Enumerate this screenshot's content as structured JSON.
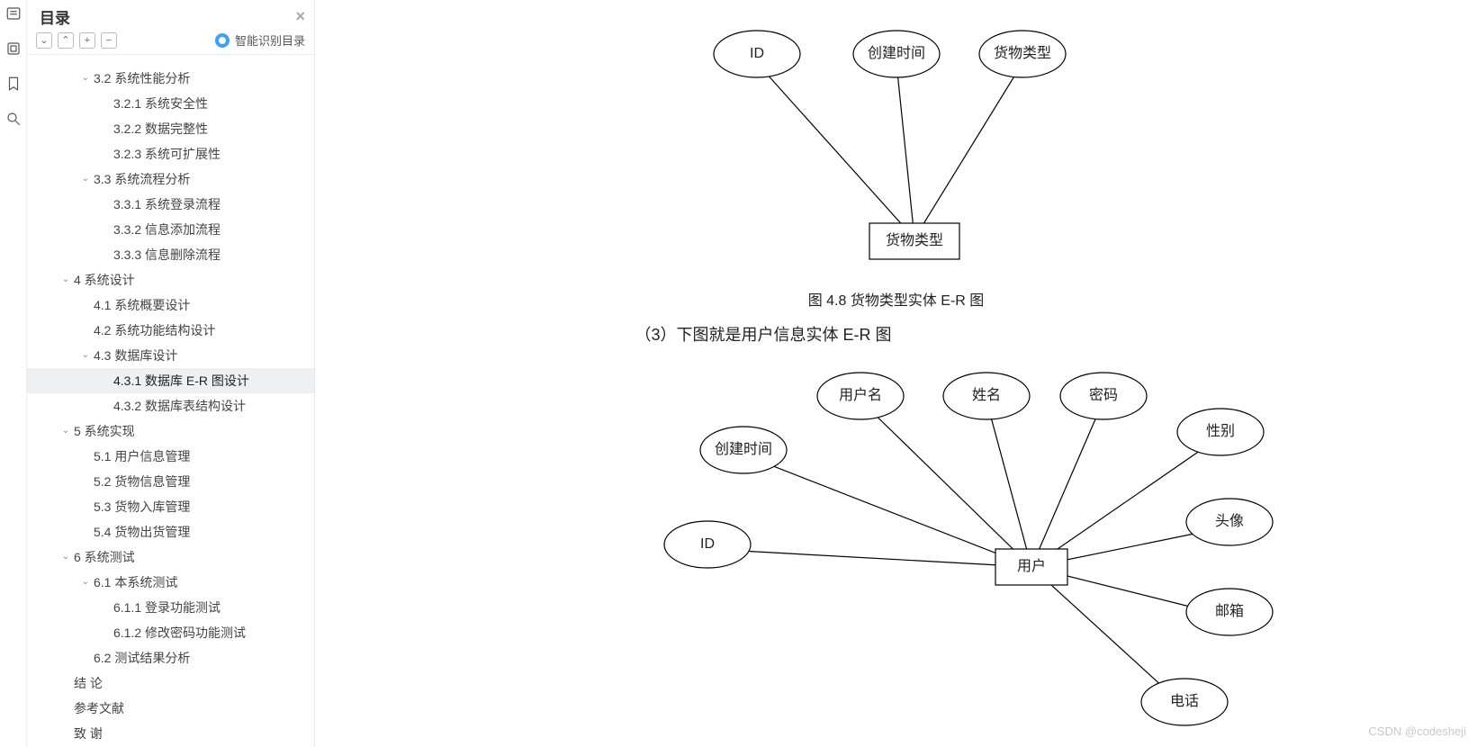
{
  "rail": {
    "icons": [
      "list-icon",
      "view-icon",
      "bookmark-icon",
      "search-icon"
    ]
  },
  "toc": {
    "title": "目录",
    "ai_label": "智能识别目录",
    "tools": [
      "⌄",
      "⌃",
      "+",
      "−"
    ],
    "items": [
      {
        "level": 3,
        "label": "",
        "chev": ""
      },
      {
        "level": 2,
        "label": "3.2 系统性能分析",
        "chev": "v"
      },
      {
        "level": 3,
        "label": "3.2.1 系统安全性",
        "chev": ""
      },
      {
        "level": 3,
        "label": "3.2.2 数据完整性",
        "chev": ""
      },
      {
        "level": 3,
        "label": "3.2.3 系统可扩展性",
        "chev": ""
      },
      {
        "level": 2,
        "label": "3.3 系统流程分析",
        "chev": "v"
      },
      {
        "level": 3,
        "label": "3.3.1 系统登录流程",
        "chev": ""
      },
      {
        "level": 3,
        "label": "3.3.2 信息添加流程",
        "chev": ""
      },
      {
        "level": 3,
        "label": "3.3.3 信息删除流程",
        "chev": ""
      },
      {
        "level": 1,
        "label": "4 系统设计",
        "chev": "v"
      },
      {
        "level": 2,
        "label": "4.1 系统概要设计",
        "chev": ""
      },
      {
        "level": 2,
        "label": "4.2 系统功能结构设计",
        "chev": ""
      },
      {
        "level": 2,
        "label": "4.3 数据库设计",
        "chev": "v"
      },
      {
        "level": 3,
        "label": "4.3.1 数据库 E-R 图设计",
        "chev": "",
        "selected": true
      },
      {
        "level": 3,
        "label": "4.3.2 数据库表结构设计",
        "chev": ""
      },
      {
        "level": 1,
        "label": "5 系统实现",
        "chev": "v"
      },
      {
        "level": 2,
        "label": "5.1 用户信息管理",
        "chev": ""
      },
      {
        "level": 2,
        "label": "5.2 货物信息管理",
        "chev": ""
      },
      {
        "level": 2,
        "label": "5.3 货物入库管理",
        "chev": ""
      },
      {
        "level": 2,
        "label": "5.4 货物出货管理",
        "chev": ""
      },
      {
        "level": 1,
        "label": "6 系统测试",
        "chev": "v"
      },
      {
        "level": 2,
        "label": "6.1 本系统测试",
        "chev": "v"
      },
      {
        "level": 3,
        "label": "6.1.1 登录功能测试",
        "chev": ""
      },
      {
        "level": 3,
        "label": "6.1.2 修改密码功能测试",
        "chev": ""
      },
      {
        "level": 2,
        "label": "6.2 测试结果分析",
        "chev": ""
      },
      {
        "level": 1,
        "label": "结  论",
        "chev": ""
      },
      {
        "level": 1,
        "label": "参考文献",
        "chev": ""
      },
      {
        "level": 1,
        "label": "致  谢",
        "chev": ""
      }
    ]
  },
  "doc": {
    "caption1": "图 4.8  货物类型实体 E-R 图",
    "para1": "（3）下图就是用户信息实体 E-R 图",
    "er1": {
      "entity": "货物类型",
      "attrs": [
        "ID",
        "创建时间",
        "货物类型"
      ]
    },
    "er2": {
      "entity": "用户",
      "attrs": [
        "用户名",
        "姓名",
        "密码",
        "性别",
        "创建时间",
        "头像",
        "ID",
        "邮箱",
        "电话"
      ]
    }
  },
  "watermark": "CSDN @codesheji"
}
